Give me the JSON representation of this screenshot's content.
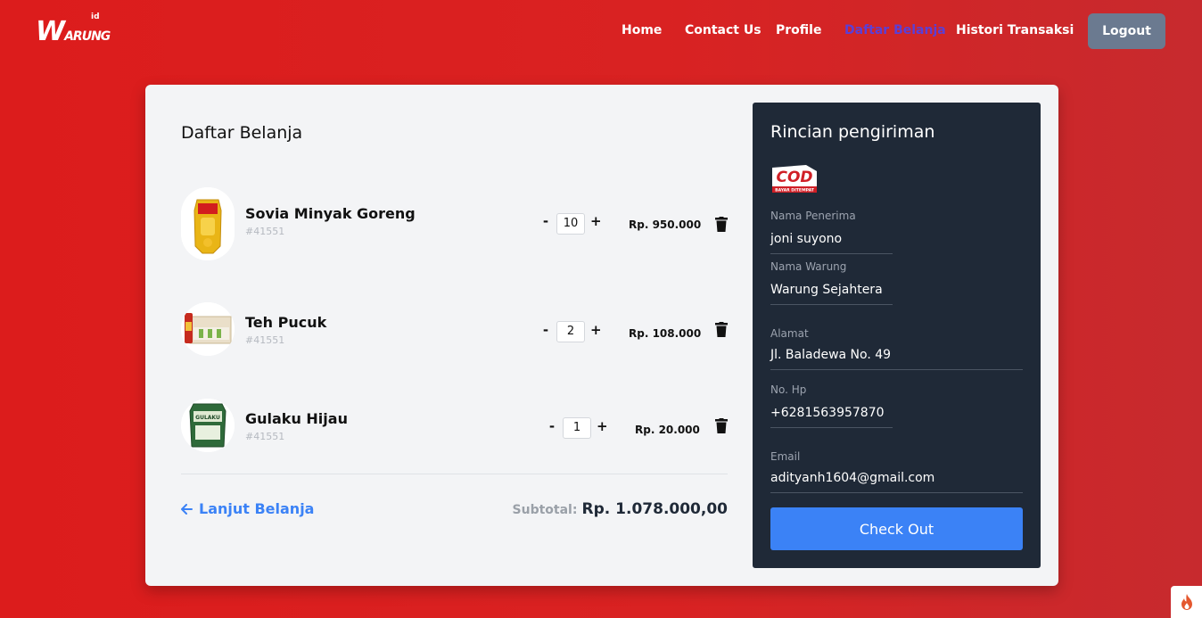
{
  "brand": {
    "logo_main": "WARUNG",
    "logo_sub": "id"
  },
  "nav": {
    "items": [
      {
        "label": "Home",
        "active": false
      },
      {
        "label": "Contact Us",
        "active": false
      },
      {
        "label": "Profile",
        "active": false
      },
      {
        "label": "Daftar Belanja",
        "active": true
      },
      {
        "label": "Histori Transaksi",
        "active": false
      }
    ],
    "logout_label": "Logout"
  },
  "cart": {
    "title": "Daftar Belanja",
    "items": [
      {
        "name": "Sovia Minyak Goreng",
        "code": "#41551",
        "qty": "10",
        "price": "Rp. 950.000",
        "minus": "-",
        "plus": "+"
      },
      {
        "name": "Teh Pucuk",
        "code": "#41551",
        "qty": "2",
        "price": "Rp. 108.000",
        "minus": "-",
        "plus": "+"
      },
      {
        "name": "Gulaku Hijau",
        "code": "#41551",
        "qty": "1",
        "price": "Rp. 20.000",
        "minus": "-",
        "plus": "+"
      }
    ],
    "continue_label": "Lanjut Belanja",
    "subtotal_label": "Subtotal:",
    "subtotal_value": "Rp. 1.078.000,00"
  },
  "shipping": {
    "title": "Rincian pengiriman",
    "cod_label": "COD",
    "cod_sub": "BAYAR DITEMPAT",
    "fields": [
      {
        "label": "Nama Penerima",
        "value": "joni suyono"
      },
      {
        "label": "Nama Warung",
        "value": "Warung Sejahtera"
      },
      {
        "label": "Alamat",
        "value": "Jl. Baladewa No. 49"
      },
      {
        "label": "No. Hp",
        "value": "+6281563957870"
      },
      {
        "label": "Email",
        "value": "adityanh1604@gmail.com"
      }
    ],
    "checkout_label": "Check Out"
  },
  "colors": {
    "background": "#dc1c1c",
    "active_nav": "#5b3fd6",
    "accent": "#3b82f6",
    "panel": "#1f2937",
    "logout": "#6b7a90"
  }
}
